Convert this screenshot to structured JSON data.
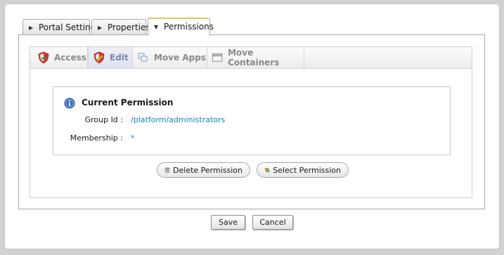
{
  "tabs": [
    {
      "label": "Portal Setting"
    },
    {
      "label": "Properties"
    },
    {
      "label": "Permissions"
    }
  ],
  "subtabs": [
    {
      "label": "Access",
      "icon": "shield-arrow-icon"
    },
    {
      "label": "Edit",
      "icon": "shield-pencil-icon"
    },
    {
      "label": "Move Apps",
      "icon": "move-apps-icon"
    },
    {
      "label": "Move Containers",
      "icon": "window-icon"
    }
  ],
  "permission": {
    "title": "Current Permission",
    "group_label": "Group Id :",
    "group_value": "/platform/administrators",
    "membership_label": "Membership :",
    "membership_value": "*"
  },
  "buttons": {
    "delete": "Delete Permission",
    "select": "Select Permission",
    "save": "Save",
    "cancel": "Cancel"
  },
  "colors": {
    "link": "#1f7fbf",
    "active_tab_accent": "#e2c36a",
    "selected_subtab_text": "#7b86a8"
  }
}
